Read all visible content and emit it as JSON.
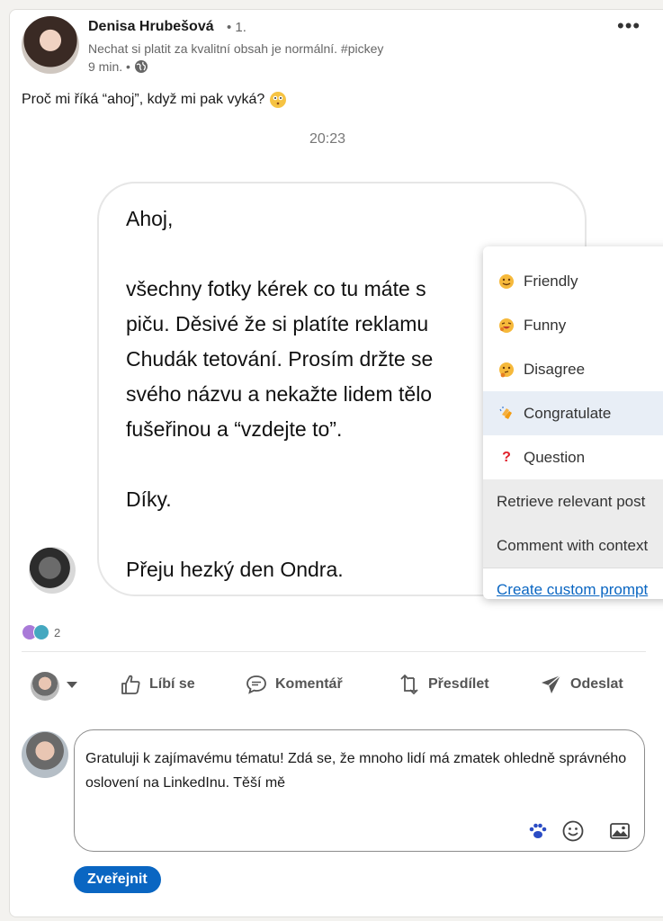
{
  "post": {
    "author_name": "Denisa Hrubešová",
    "degree": "• 1.",
    "headline": "Nechat si platit za kvalitní obsah je normální. #pickey",
    "time": "9 min. •",
    "text": "Proč mi říká “ahoj”, když mi pak vyká?",
    "more_label": "•••"
  },
  "image": {
    "timestamp": "20:23",
    "message_lines": [
      "Ahoj,",
      "",
      "všechny fotky kérek co tu máte s",
      "piču. Děsivé že si platíte reklamu",
      "Chudák tetování. Prosím držte se",
      "svého názvu a nekažte lidem tělo",
      "fušeřinou a “vzdejte to”.",
      "",
      "Díky.",
      "",
      "Přeju hezký den Ondra."
    ]
  },
  "menu": {
    "items": [
      {
        "label": "Friendly",
        "icon": "smile-emoji-icon"
      },
      {
        "label": "Funny",
        "icon": "laugh-emoji-icon"
      },
      {
        "label": "Disagree",
        "icon": "thinking-emoji-icon"
      },
      {
        "label": "Congratulate",
        "icon": "clap-emoji-icon"
      },
      {
        "label": "Question",
        "icon": "question-mark-icon"
      },
      {
        "label": "Retrieve relevant post"
      },
      {
        "label": "Comment with context"
      },
      {
        "label": "Create custom prompt"
      }
    ]
  },
  "reactions": {
    "count": "2"
  },
  "actions": {
    "like": "Líbí se",
    "comment": "Komentář",
    "repost": "Přesdílet",
    "send": "Odeslat"
  },
  "comment": {
    "value": "Gratuluji k zajímavému tématu! Zdá se, že mnoho lidí má zmatek ohledně správného oslovení na LinkedInu. Těší mě",
    "publish_label": "Zveřejnit"
  },
  "colors": {
    "accent": "#0a66c2",
    "menu_highlight": "#e8eef6",
    "menu_grey": "#ececec"
  }
}
